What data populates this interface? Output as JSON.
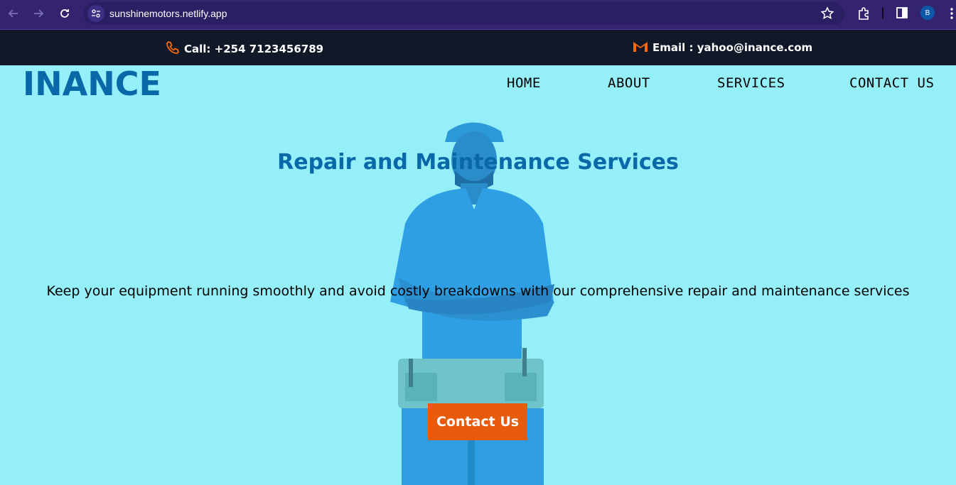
{
  "browser": {
    "url": "sunshinemotors.netlify.app",
    "profile_initial": "B",
    "icons": [
      "back-arrow-icon",
      "forward-arrow-icon",
      "reload-icon",
      "site-settings-icon",
      "bookmark-star-icon",
      "extensions-icon",
      "side-panel-icon",
      "more-options-icon"
    ]
  },
  "info_bar": {
    "phone_label": "Call: +254 7123456789",
    "email_label": "Email : yahoo@inance.com",
    "icons": [
      "phone-icon",
      "gmail-icon"
    ]
  },
  "header": {
    "logo": "INANCE",
    "nav": [
      {
        "label": "HOME"
      },
      {
        "label": "ABOUT"
      },
      {
        "label": "SERVICES"
      },
      {
        "label": "CONTACT US"
      }
    ]
  },
  "hero": {
    "title": "Repair and Maintenance Services",
    "description": "Keep your equipment running smoothly and avoid costly breakdowns with our comprehensive repair and maintenance services",
    "cta_label": "Contact Us"
  },
  "colors": {
    "background": "#94eff8",
    "brand_blue": "#0868a8",
    "accent_orange": "#e85a0c",
    "info_bar": "#111827",
    "browser_bar": "#342470"
  }
}
